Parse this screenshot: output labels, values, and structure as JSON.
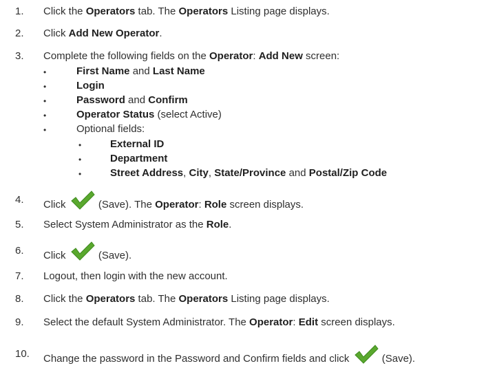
{
  "steps": [
    {
      "num": "1.",
      "t": [
        "Click the ",
        "Operators",
        " tab. The ",
        "Operators",
        " Listing page displays."
      ]
    },
    {
      "num": "2.",
      "t": [
        "Click ",
        "Add New Operator",
        "."
      ]
    },
    {
      "num": "3.",
      "t": [
        "Complete the following fields on the ",
        "Operator",
        ": ",
        "Add New",
        " screen:"
      ]
    },
    {
      "num": "4.",
      "a": "Click ",
      "b": " (Save). The ",
      "c": "Operator",
      "d": ": ",
      "e": "Role",
      "f": " screen displays."
    },
    {
      "num": "5.",
      "t": [
        "Select System Administrator as the ",
        "Role",
        "."
      ]
    },
    {
      "num": "6.",
      "a": "Click ",
      "b": " (Save)."
    },
    {
      "num": "7.",
      "t": "Logout, then login with the new account."
    },
    {
      "num": "8.",
      "t": [
        "Click the ",
        "Operators",
        " tab. The ",
        "Operators",
        " Listing page displays."
      ]
    },
    {
      "num": "9.",
      "t": [
        "Select the default System Administrator. The ",
        "Operator",
        ": ",
        "Edit",
        " screen displays."
      ]
    },
    {
      "num": "10.",
      "a": "Change the password in the Password and Confirm fields and click ",
      "b": " (Save)."
    }
  ],
  "bullets": [
    {
      "t": [
        "First Name",
        " and ",
        "Last Name"
      ]
    },
    {
      "t": [
        "Login"
      ]
    },
    {
      "t": [
        "Password",
        " and ",
        "Confirm"
      ]
    },
    {
      "t": [
        "Operator Status",
        " (select Active)"
      ]
    },
    {
      "t": [
        "Optional fields:"
      ]
    }
  ],
  "sub_bullets": [
    {
      "t": [
        "External ID"
      ]
    },
    {
      "t": [
        "Department"
      ]
    },
    {
      "t": [
        "Street Address",
        ", ",
        "City",
        ", ",
        "State/Province",
        " and ",
        "Postal/Zip Code"
      ]
    }
  ],
  "bullet_char": "•",
  "icons": {
    "save": "checkmark-save-icon",
    "color": "#5aa82e"
  }
}
